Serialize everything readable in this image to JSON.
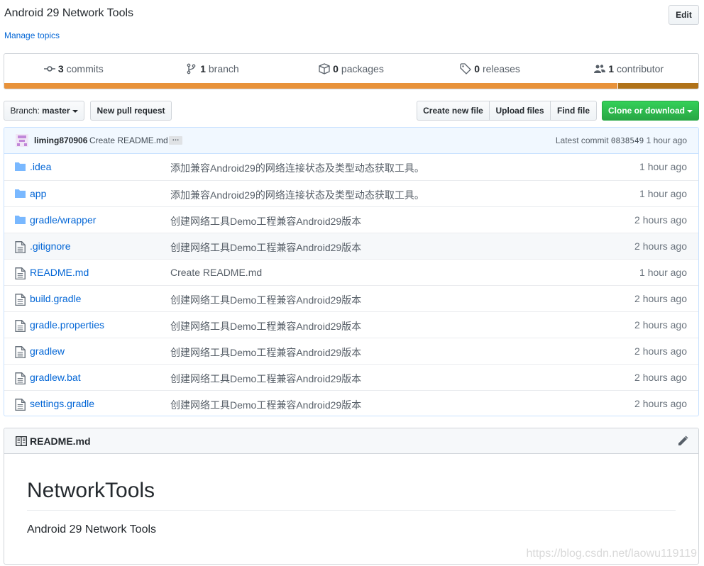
{
  "repo": {
    "description": "Android 29 Network Tools",
    "edit_label": "Edit",
    "manage_topics": "Manage topics"
  },
  "summary": {
    "commits_count": "3",
    "commits_label": "commits",
    "branch_count": "1",
    "branch_label": "branch",
    "packages_count": "0",
    "packages_label": "packages",
    "releases_count": "0",
    "releases_label": "releases",
    "contributor_count": "1",
    "contributor_label": "contributor",
    "language_colors": [
      "#e8923a",
      "#b07219"
    ]
  },
  "toolbar": {
    "branch_prefix": "Branch:",
    "branch_name": "master",
    "new_pull_request": "New pull request",
    "create_new_file": "Create new file",
    "upload_files": "Upload files",
    "find_file": "Find file",
    "clone_or_download": "Clone or download"
  },
  "latest_commit": {
    "author": "liming870906",
    "message": "Create README.md",
    "ellipsis": "…",
    "prefix": "Latest commit",
    "sha": "0838549",
    "age": "1 hour ago"
  },
  "files": [
    {
      "type": "folder",
      "name": ".idea",
      "message": "添加兼容Android29的网络连接状态及类型动态获取工具。",
      "age": "1 hour ago"
    },
    {
      "type": "folder",
      "name": "app",
      "message": "添加兼容Android29的网络连接状态及类型动态获取工具。",
      "age": "1 hour ago"
    },
    {
      "type": "folder",
      "name": "gradle/wrapper",
      "message": "创建网络工具Demo工程兼容Android29版本",
      "age": "2 hours ago"
    },
    {
      "type": "file",
      "name": ".gitignore",
      "message": "创建网络工具Demo工程兼容Android29版本",
      "age": "2 hours ago"
    },
    {
      "type": "file",
      "name": "README.md",
      "message": "Create README.md",
      "age": "1 hour ago"
    },
    {
      "type": "file",
      "name": "build.gradle",
      "message": "创建网络工具Demo工程兼容Android29版本",
      "age": "2 hours ago"
    },
    {
      "type": "file",
      "name": "gradle.properties",
      "message": "创建网络工具Demo工程兼容Android29版本",
      "age": "2 hours ago"
    },
    {
      "type": "file",
      "name": "gradlew",
      "message": "创建网络工具Demo工程兼容Android29版本",
      "age": "2 hours ago"
    },
    {
      "type": "file",
      "name": "gradlew.bat",
      "message": "创建网络工具Demo工程兼容Android29版本",
      "age": "2 hours ago"
    },
    {
      "type": "file",
      "name": "settings.gradle",
      "message": "创建网络工具Demo工程兼容Android29版本",
      "age": "2 hours ago"
    }
  ],
  "readme": {
    "filename": "README.md",
    "heading": "NetworkTools",
    "body": "Android 29 Network Tools"
  },
  "watermark": "https://blog.csdn.net/laowu119119"
}
